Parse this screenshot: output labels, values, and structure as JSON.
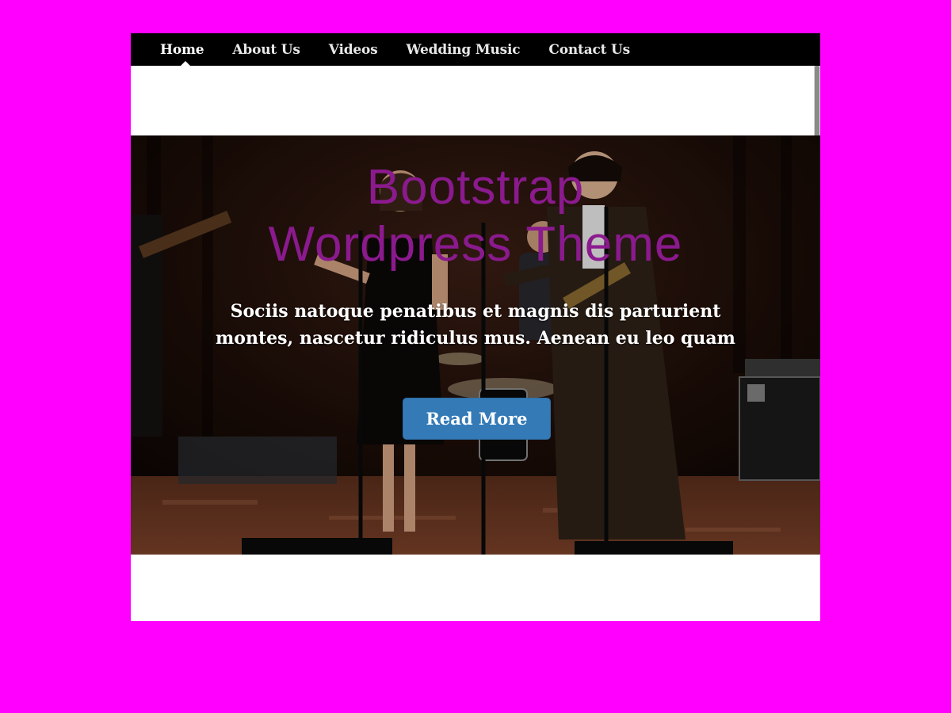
{
  "nav": {
    "items": [
      {
        "label": "Home",
        "active": true
      },
      {
        "label": "About Us",
        "active": false
      },
      {
        "label": "Videos",
        "active": false
      },
      {
        "label": "Wedding Music",
        "active": false
      },
      {
        "label": "Contact Us",
        "active": false
      }
    ]
  },
  "hero": {
    "title_line1": "Bootstrap",
    "title_line2": "Wordpress Theme",
    "text_line1": "Sociis natoque penatibus et magnis dis parturient",
    "text_line2": "montes, nascetur ridiculus mus. Aenean eu leo quam",
    "button_label": "Read More",
    "background_image": "band-performing-on-stage-photo"
  },
  "colors": {
    "page_background": "#ff00ff",
    "navbar_background": "#000000",
    "title_color": "#8b1a8e",
    "button_color": "#337ab7"
  }
}
